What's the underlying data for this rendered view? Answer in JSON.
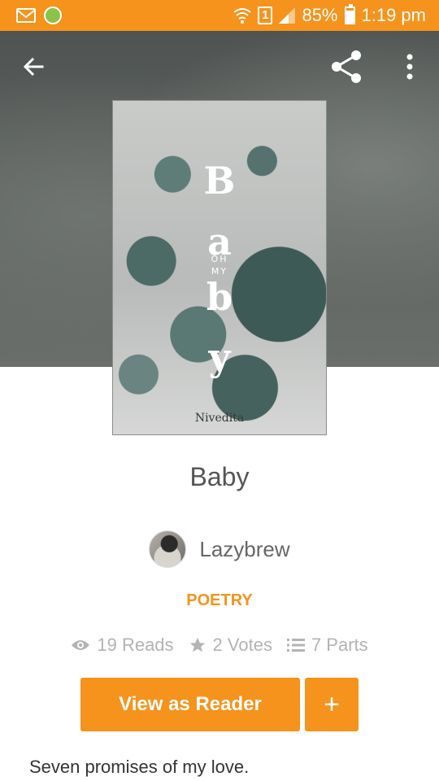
{
  "status_bar": {
    "sim": "1",
    "battery": "85%",
    "time": "1:19 pm"
  },
  "header": {
    "icons": [
      "back-arrow-icon",
      "share-icon",
      "more-vertical-icon"
    ]
  },
  "cover": {
    "letters": [
      "B",
      "a",
      "b",
      "y"
    ],
    "small_text_1": "OH",
    "small_text_2": "MY",
    "author_text": "Nivedita"
  },
  "story": {
    "title": "Baby",
    "author": "Lazybrew",
    "category": "POETRY",
    "reads": "19 Reads",
    "votes": "2 Votes",
    "parts": "7 Parts",
    "description": "Seven promises of my love."
  },
  "actions": {
    "view_as_reader": "View as Reader",
    "add_label": "+"
  },
  "colors": {
    "accent": "#f5931c",
    "stats_gray": "#b3b3b3"
  }
}
